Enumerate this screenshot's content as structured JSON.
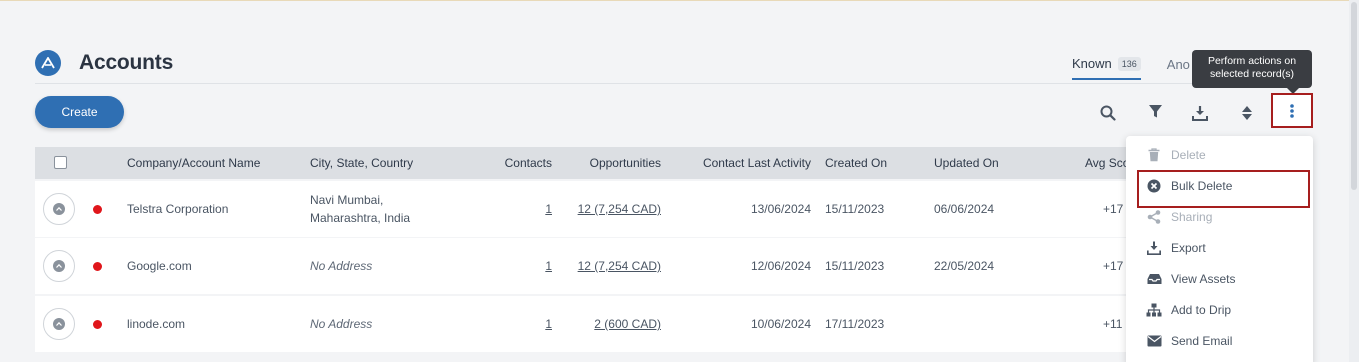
{
  "header": {
    "title": "Accounts"
  },
  "tabs": [
    {
      "label": "Known",
      "count": "136"
    },
    {
      "label": "Ano"
    }
  ],
  "tooltip": {
    "line1": "Perform actions on",
    "line2": "selected record(s)"
  },
  "toolbar": {
    "create_label": "Create"
  },
  "table": {
    "columns": [
      "Company/Account Name",
      "City, State, Country",
      "Contacts",
      "Opportunities",
      "Contact Last Activity",
      "Created On",
      "Updated On",
      "Avg Sco"
    ],
    "rows": [
      {
        "name": "Telstra Corporation",
        "address_line1": "Navi Mumbai,",
        "address_line2": "Maharashtra, India",
        "contacts": "1",
        "opportunities": "12 (7,254 CAD)",
        "last_activity": "13/06/2024",
        "created_on": "15/11/2023",
        "updated_on": "06/06/2024",
        "avg_score": "+17"
      },
      {
        "name": "Google.com",
        "address_line1": "No Address",
        "address_line2": "",
        "contacts": "1",
        "opportunities": "12 (7,254 CAD)",
        "last_activity": "12/06/2024",
        "created_on": "15/11/2023",
        "updated_on": "22/05/2024",
        "avg_score": "+17"
      },
      {
        "name": "linode.com",
        "address_line1": "No Address",
        "address_line2": "",
        "contacts": "1",
        "opportunities": "2 (600 CAD)",
        "last_activity": "10/06/2024",
        "created_on": "17/11/2023",
        "updated_on": "",
        "avg_score": "+11"
      }
    ]
  },
  "menu": {
    "items": [
      {
        "label": "Delete",
        "icon": "trash-icon",
        "disabled": true
      },
      {
        "label": "Bulk Delete",
        "icon": "x-circle-icon",
        "disabled": false
      },
      {
        "label": "Sharing",
        "icon": "share-icon",
        "disabled": true
      },
      {
        "label": "Export",
        "icon": "download-icon",
        "disabled": false
      },
      {
        "label": "View Assets",
        "icon": "inbox-icon",
        "disabled": false
      },
      {
        "label": "Add to Drip",
        "icon": "hierarchy-icon",
        "disabled": false
      },
      {
        "label": "Send Email",
        "icon": "envelope-icon",
        "disabled": false
      }
    ]
  },
  "colors": {
    "accent": "#2f6fb3",
    "status_red": "#e0161b",
    "highlight_border": "#a61e1e"
  }
}
